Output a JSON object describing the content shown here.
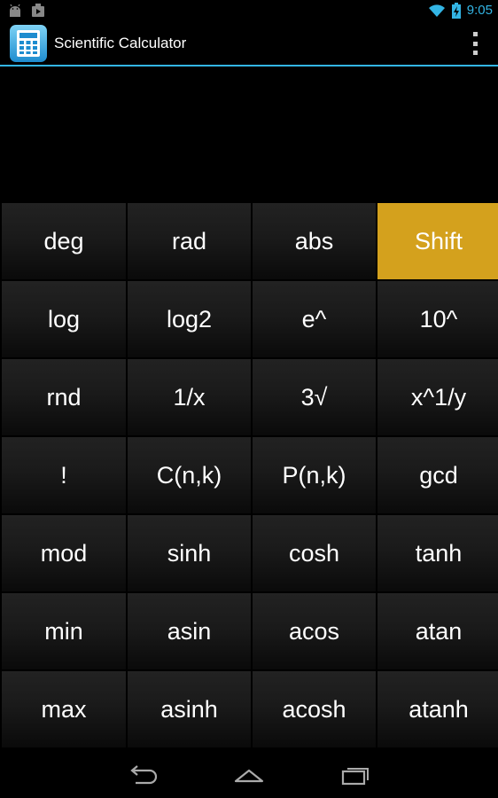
{
  "status_bar": {
    "time": "9:05",
    "icons_left": [
      "android-icon",
      "media-icon"
    ],
    "icons_right": [
      "wifi-icon",
      "battery-icon"
    ]
  },
  "action_bar": {
    "title": "Scientific Calculator",
    "app_icon": "calculator-icon",
    "overflow_icon": "overflow-menu-icon"
  },
  "display": {
    "value": ""
  },
  "keypad": {
    "rows": [
      [
        "deg",
        "rad",
        "abs",
        "Shift"
      ],
      [
        "log",
        "log2",
        "e^",
        "10^"
      ],
      [
        "rnd",
        "1/x",
        "3√",
        "x^1/y"
      ],
      [
        "!",
        "C(n,k)",
        "P(n,k)",
        "gcd"
      ],
      [
        "mod",
        "sinh",
        "cosh",
        "tanh"
      ],
      [
        "min",
        "asin",
        "acos",
        "atan"
      ],
      [
        "max",
        "asinh",
        "acosh",
        "atanh"
      ]
    ],
    "highlighted_key": "Shift"
  },
  "colors": {
    "accent": "#33b5e5",
    "shift": "#d4a11d",
    "background": "#000000"
  },
  "nav_bar": {
    "buttons": [
      "back-icon",
      "home-icon",
      "recent-apps-icon"
    ]
  }
}
